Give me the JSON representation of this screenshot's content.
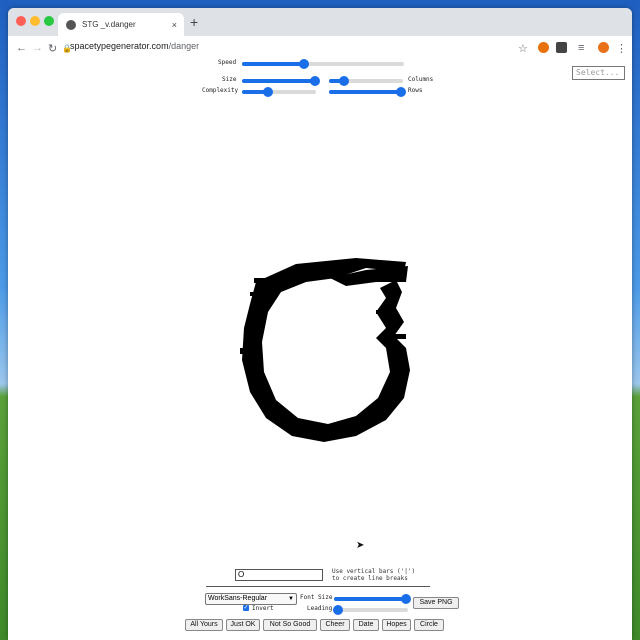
{
  "browser": {
    "tab_title": "STG _v.danger",
    "tab_close": "×",
    "new_tab": "+",
    "url_host": "spacetypegenerator.com",
    "url_path": "/danger"
  },
  "controls": {
    "speed_label": "Speed",
    "size_label": "Size",
    "complexity_label": "Complexity",
    "columns_label": "Columns",
    "rows_label": "Rows",
    "speed_value": 0.38,
    "size_value": 0.98,
    "complexity_value": 0.35,
    "columns_value": 0.2,
    "rows_value": 0.97,
    "select_placeholder": "Select..."
  },
  "bottom": {
    "text_value": "O",
    "hint_line1": "Use vertical bars ('|')",
    "hint_line2": "to create line breaks",
    "font_select": "WorkSans-Regular",
    "invert_label": "Invert",
    "font_size_label": "Font Size",
    "leading_label": "Leading",
    "font_size_value": 0.97,
    "leading_value": 0.05,
    "save_png": "Save PNG",
    "presets": [
      "All Yours",
      "Just OK",
      "Not So Good",
      "Cheer",
      "Date",
      "Hopes",
      "Circle"
    ]
  },
  "colors": {
    "accent": "#1a6fe8",
    "glyph": "#000000"
  },
  "icons": [
    "back-icon",
    "forward-icon",
    "reload-icon",
    "lock-icon",
    "star-icon",
    "extension-icon",
    "profile-avatar",
    "menu-icon"
  ]
}
